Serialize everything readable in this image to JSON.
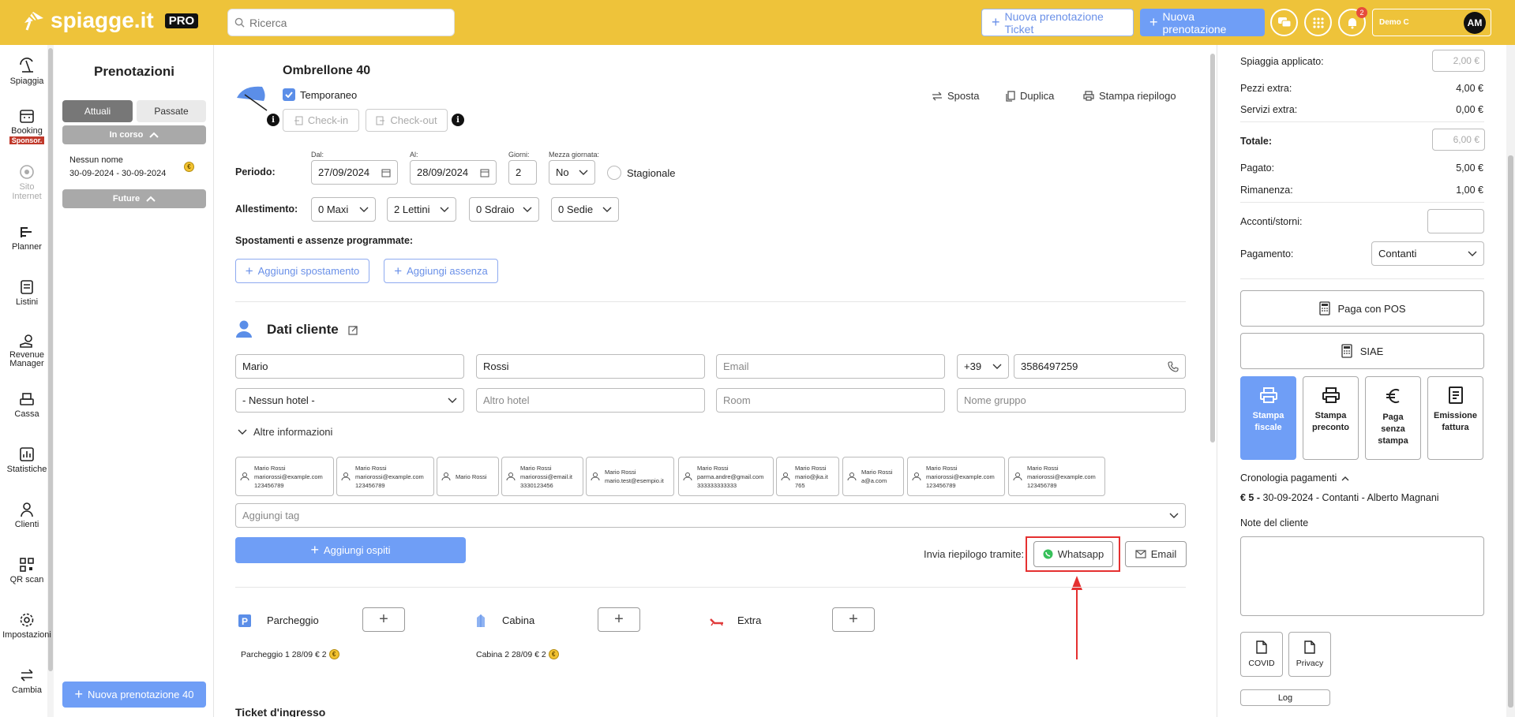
{
  "topbar": {
    "logo_text": "spiagge.it",
    "pro_label": "PRO",
    "search_placeholder": "Ricerca",
    "new_ticket_label": "Nuova prenotazione Ticket",
    "new_booking_label": "Nuova prenotazione",
    "notif_count": "2",
    "user_name": "Demo C",
    "user_initials": "AM"
  },
  "nav": {
    "items": [
      {
        "label": "Spiaggia"
      },
      {
        "label": "Booking",
        "badge": "Sponsor."
      },
      {
        "label": "Sito Internet"
      },
      {
        "label": "Planner"
      },
      {
        "label": "Listini"
      },
      {
        "label": "Revenue Manager"
      },
      {
        "label": "Cassa"
      },
      {
        "label": "Statistiche"
      },
      {
        "label": "Clienti"
      },
      {
        "label": "QR scan"
      },
      {
        "label": "Impostazioni"
      },
      {
        "label": "Cambia"
      }
    ]
  },
  "bookings": {
    "title": "Prenotazioni",
    "tab_current": "Attuali",
    "tab_past": "Passate",
    "in_progress": "In corso",
    "future": "Future",
    "item_name": "Nessun nome",
    "item_dates": "30-09-2024 - 30-09-2024",
    "coin_symbol": "€",
    "new_button": "Nuova prenotazione 40"
  },
  "booking": {
    "title": "Ombrellone 40",
    "temporary_label": "Temporaneo",
    "checkin_label": "Check-in",
    "checkout_label": "Check-out",
    "actions": {
      "move": "Sposta",
      "duplicate": "Duplica",
      "print": "Stampa riepilogo"
    },
    "period_label": "Periodo:",
    "from_label": "Dal:",
    "from_value": "27/09/2024",
    "to_label": "Al:",
    "to_value": "28/09/2024",
    "days_label": "Giorni:",
    "days_value": "2",
    "half_day_label": "Mezza giornata:",
    "half_day_value": "No",
    "seasonal_label": "Stagionale",
    "setup_label": "Allestimento:",
    "setup": [
      "0 Maxi",
      "2 Lettini",
      "0 Sdraio",
      "0 Sedie"
    ],
    "scheduled_label": "Spostamenti e assenze programmate:",
    "add_move": "Aggiungi spostamento",
    "add_absence": "Aggiungi assenza"
  },
  "customer": {
    "section_title": "Dati cliente",
    "first_name": "Mario",
    "last_name": "Rossi",
    "email_placeholder": "Email",
    "prefix": "+39",
    "phone": "3586497259",
    "hotel": "- Nessun hotel -",
    "other_hotel_placeholder": "Altro hotel",
    "room_placeholder": "Room",
    "group_placeholder": "Nome gruppo",
    "more_info": "Altre informazioni",
    "guests": [
      {
        "name": "Mario Rossi",
        "email": "mariorossi@example.com",
        "phone": "123456789"
      },
      {
        "name": "Mario Rossi",
        "email": "mariorossi@example.com",
        "phone": "123456789"
      },
      {
        "name": "Mario Rossi",
        "email": "",
        "phone": ""
      },
      {
        "name": "Mario Rossi",
        "email": "mariorossi@email.it",
        "phone": "3330123456"
      },
      {
        "name": "Mario Rossi",
        "email": "mario.test@esempio.it",
        "phone": ""
      },
      {
        "name": "Mario Rossi",
        "email": "parma.andre@gmail.com",
        "phone": "333333333333"
      },
      {
        "name": "Mario Rossi",
        "email": "mario@jka.it",
        "phone": "765"
      },
      {
        "name": "Mario Rossi",
        "email": "a@a.com",
        "phone": ""
      },
      {
        "name": "Mario Rossi",
        "email": "mariorossi@example.com",
        "phone": "123456789"
      },
      {
        "name": "Mario Rossi",
        "email": "mariorossi@example.com",
        "phone": "123456789"
      }
    ],
    "tag_placeholder": "Aggiungi tag",
    "add_guests": "Aggiungi ospiti",
    "send_summary_label": "Invia riepilogo tramite:",
    "whatsapp_label": "Whatsapp",
    "email_label": "Email"
  },
  "extras": {
    "parking_label": "Parcheggio",
    "cabin_label": "Cabina",
    "extra_label": "Extra",
    "parking_line": "Parcheggio 1 28/09 € 2",
    "cabin_line": "Cabina 2 28/09 € 2",
    "ticket_title": "Ticket d'ingresso"
  },
  "payment": {
    "beach_applied_label": "Spiaggia applicato:",
    "beach_applied_value": "2,00 €",
    "extra_pieces_label": "Pezzi extra:",
    "extra_pieces_value": "4,00 €",
    "extra_services_label": "Servizi extra:",
    "extra_services_value": "0,00 €",
    "total_label": "Totale:",
    "total_value": "6,00 €",
    "paid_label": "Pagato:",
    "paid_value": "5,00 €",
    "remaining_label": "Rimanenza:",
    "remaining_value": "1,00 €",
    "deposits_label": "Acconti/storni:",
    "method_label": "Pagamento:",
    "method_value": "Contanti",
    "pos_label": "Paga con POS",
    "siae_label": "SIAE",
    "tiles": [
      "Stampa fiscale",
      "Stampa preconto",
      "Paga senza stampa",
      "Emissione fattura"
    ],
    "history_label": "Cronologia pagamenti",
    "history_amount": "€ 5 -",
    "history_entry": "30-09-2024 - Contanti - Alberto Magnani",
    "notes_label": "Note del cliente",
    "covid_label": "COVID",
    "privacy_label": "Privacy",
    "log_label": "Log"
  },
  "colors": {
    "topbar": "#eec33a",
    "accent": "#6f9ef6",
    "highlight": "#e53030"
  }
}
